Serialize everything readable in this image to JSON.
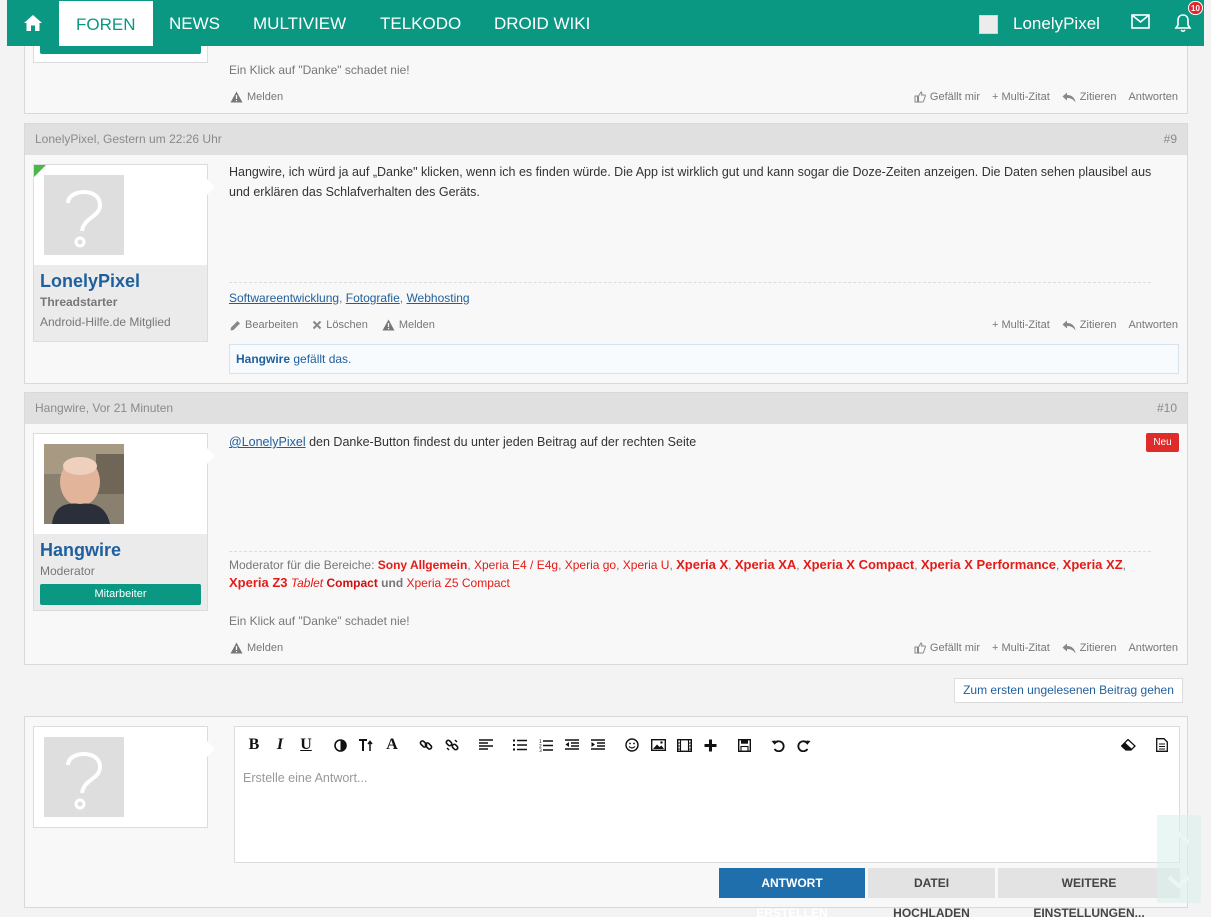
{
  "nav": {
    "items": [
      "Foren",
      "News",
      "Multiview",
      "Telkodo",
      "Droid Wiki"
    ],
    "username": "LonelyPixel",
    "notification_count": "10"
  },
  "post8": {
    "thanks_note": "Ein Klick auf \"Danke\" schadet nie!",
    "report": "Melden",
    "like": "Gefällt mir",
    "multiquote": "+ Multi-Zitat",
    "quote": "Zitieren",
    "reply": "Antworten"
  },
  "post9": {
    "meta": "LonelyPixel, Gestern um 22:26 Uhr",
    "number": "#9",
    "username": "LonelyPixel",
    "user_title": "Threadstarter",
    "user_status": "Android-Hilfe.de Mitglied",
    "message": "Hangwire, ich würd ja auf „Danke\" klicken, wenn ich es finden würde. Die App ist wirklich gut und kann sogar die Doze-Zeiten anzeigen. Die Daten sehen plausibel aus und erklären das Schlafverhalten des Geräts.",
    "sig_links": [
      "Softwareentwicklung",
      "Fotografie",
      "Webhosting"
    ],
    "edit": "Bearbeiten",
    "delete": "Löschen",
    "report": "Melden",
    "multiquote": "+ Multi-Zitat",
    "quote": "Zitieren",
    "reply": "Antworten",
    "liker": "Hangwire",
    "likes_suffix": " gefällt das."
  },
  "post10": {
    "meta": "Hangwire, Vor 21 Minuten",
    "number": "#10",
    "username": "Hangwire",
    "user_role": "Moderator",
    "staff_label": "Mitarbeiter",
    "mention": "@LonelyPixel",
    "message": " den Danke-Button findest du unter jeden Beitrag auf der rechten Seite",
    "new_badge": "Neu",
    "mod_prefix": "Moderator für die Bereiche: ",
    "mod_areas": {
      "a1": "Sony Allgemein",
      "a2": "Xperia E4 / E4g",
      "a3": "Xperia go",
      "a4": "Xperia U",
      "a5": "Xperia X",
      "a6": "Xperia XA",
      "a7": "Xperia X Compact",
      "a8": "Xperia X Performance",
      "a9": "Xperia XZ",
      "a10": "Xperia Z3",
      "a10b": "Tablet",
      "a10c": "Compact",
      "und": "und",
      "a11": "Xperia Z5 Compact"
    },
    "thanks_note": "Ein Klick auf \"Danke\" schadet nie!",
    "report": "Melden",
    "like": "Gefällt mir",
    "multiquote": "+ Multi-Zitat",
    "quote": "Zitieren",
    "reply": "Antworten"
  },
  "unread_link": "Zum ersten ungelesenen Beitrag gehen",
  "reply_box": {
    "placeholder": "Erstelle eine Antwort...",
    "toolbar": {
      "bold": "B",
      "italic": "I",
      "underline": "U",
      "font": "A"
    },
    "submit": "Antwort erstellen",
    "upload": "Datei hochladen",
    "more": "Weitere Einstellungen..."
  },
  "colors": {
    "brand": "#0b9882",
    "link": "#1f5f9e",
    "moderator_red": "#e41b17",
    "primary_button": "#1f6fad"
  }
}
